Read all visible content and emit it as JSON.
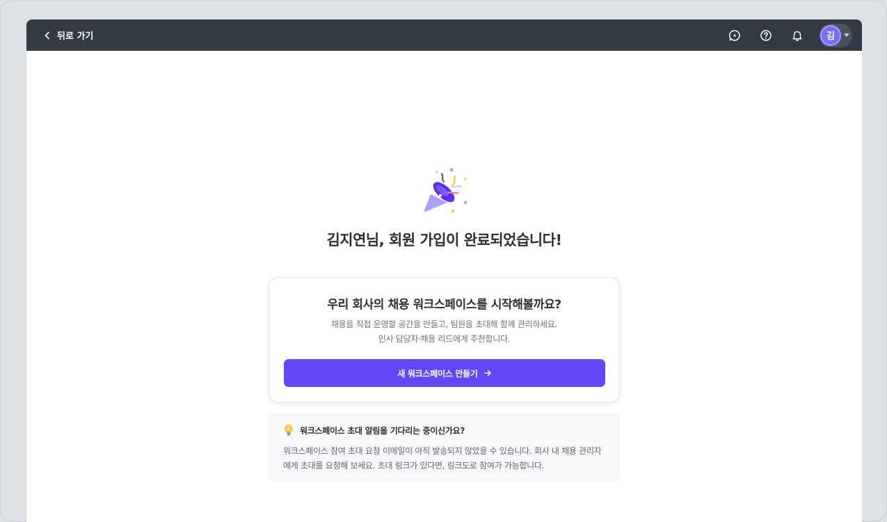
{
  "topbar": {
    "back_label": "뒤로 가기",
    "icons": [
      "message-icon",
      "help-icon",
      "bell-icon"
    ],
    "avatar_initial": "김"
  },
  "main": {
    "headline": "김지연님, 회원 가입이 완료되었습니다!",
    "card": {
      "title": "우리 회사의 채용 워크스페이스를 시작해볼까요?",
      "desc_line1": "채용을 직접 운영할 공간을 만들고, 팀원을 초대해 함께 관리하세요.",
      "desc_line2": "인사 담당자·채용 리드에게 추천합니다.",
      "cta_label": "새 워크스페이스 만들기"
    },
    "notice": {
      "icon": "lightbulb-icon",
      "title": "워크스페이스 초대 알림을 기다리는 중이신가요?",
      "body": "워크스페이스 참여 초대 요청 이메일이 아직 발송되지 않았을 수 있습니다. 회사 내 채용 관리자에게 초대를 요청해 보세요. 초대 링크가 있다면, 링크도로 참여가 가능합니다."
    }
  },
  "colors": {
    "topbar": "#323943",
    "accent": "#6246fa",
    "avatar": "#7c6df5",
    "background": "#dde1e6"
  }
}
